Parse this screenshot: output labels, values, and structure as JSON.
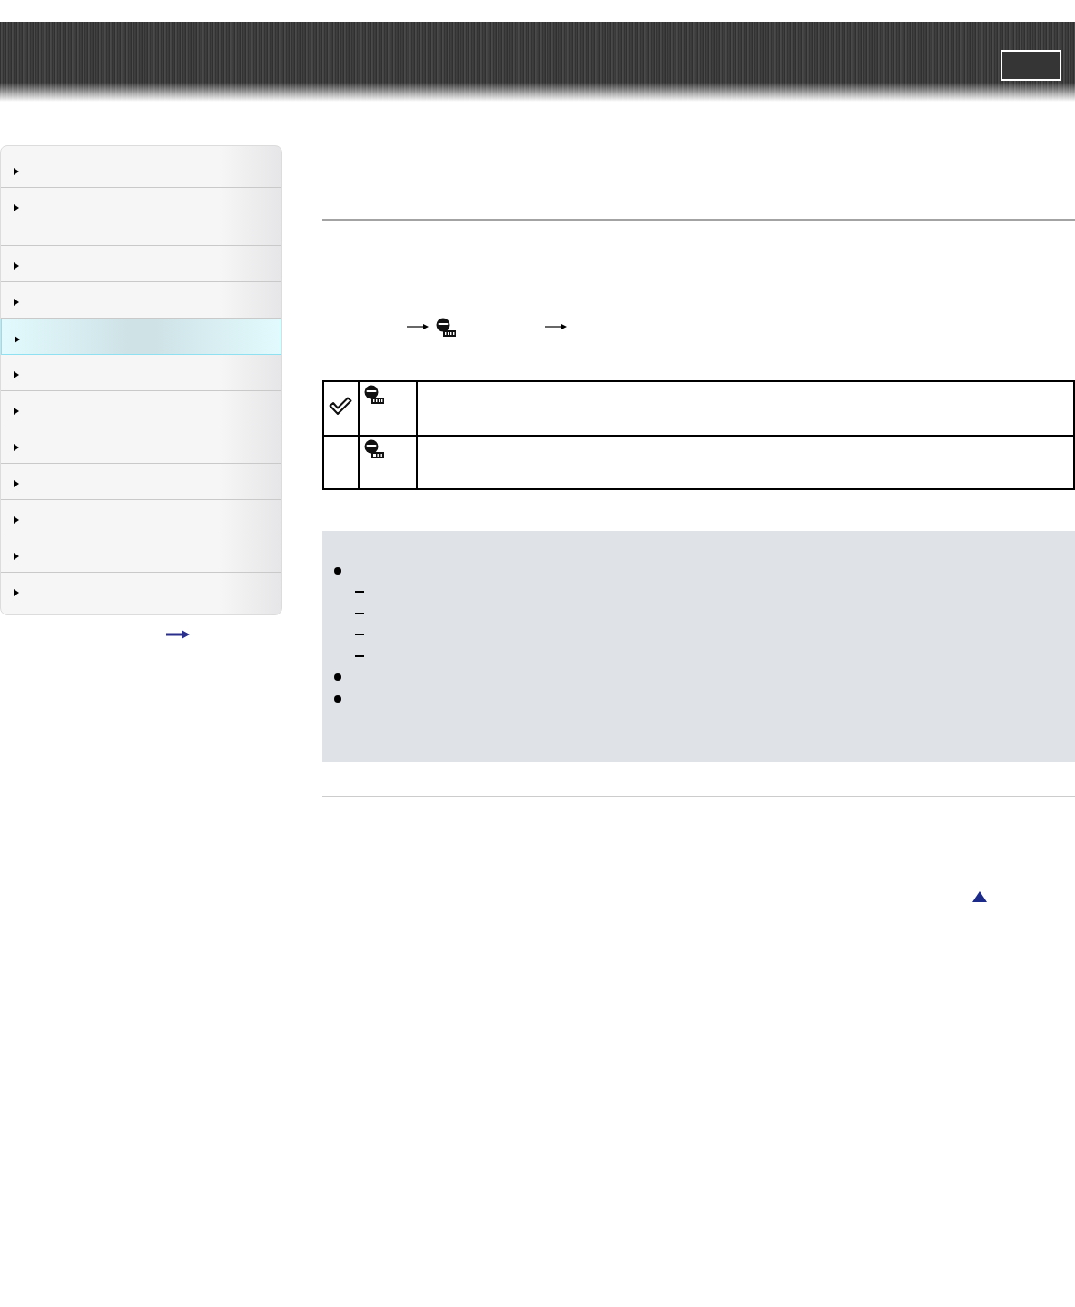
{
  "sidebar": {
    "items": [
      {
        "kind": "one_line",
        "selected": false
      },
      {
        "kind": "two_line",
        "selected": false
      },
      {
        "kind": "one_line",
        "selected": false
      },
      {
        "kind": "one_line",
        "selected": false
      },
      {
        "kind": "one_line",
        "selected": true
      },
      {
        "kind": "one_line",
        "selected": false
      },
      {
        "kind": "one_line",
        "selected": false
      },
      {
        "kind": "one_line",
        "selected": false
      },
      {
        "kind": "one_line",
        "selected": false
      },
      {
        "kind": "one_line",
        "selected": false
      },
      {
        "kind": "one_line",
        "selected": false
      },
      {
        "kind": "one_line",
        "selected": false
      }
    ]
  },
  "instruction": {
    "steps": [
      {
        "kind": "arrow"
      },
      {
        "kind": "icon"
      },
      {
        "kind": "arrow"
      }
    ]
  },
  "table": {
    "rows": [
      {
        "checked": true,
        "kind": "auto"
      },
      {
        "checked": false,
        "kind": "off"
      }
    ]
  },
  "notes": {
    "items": [
      {
        "kind": "bullet",
        "children": [
          {
            "kind": "dash"
          },
          {
            "kind": "dash"
          },
          {
            "kind": "dash"
          },
          {
            "kind": "dash"
          }
        ]
      },
      {
        "kind": "bullet"
      },
      {
        "kind": "bullet"
      }
    ]
  }
}
